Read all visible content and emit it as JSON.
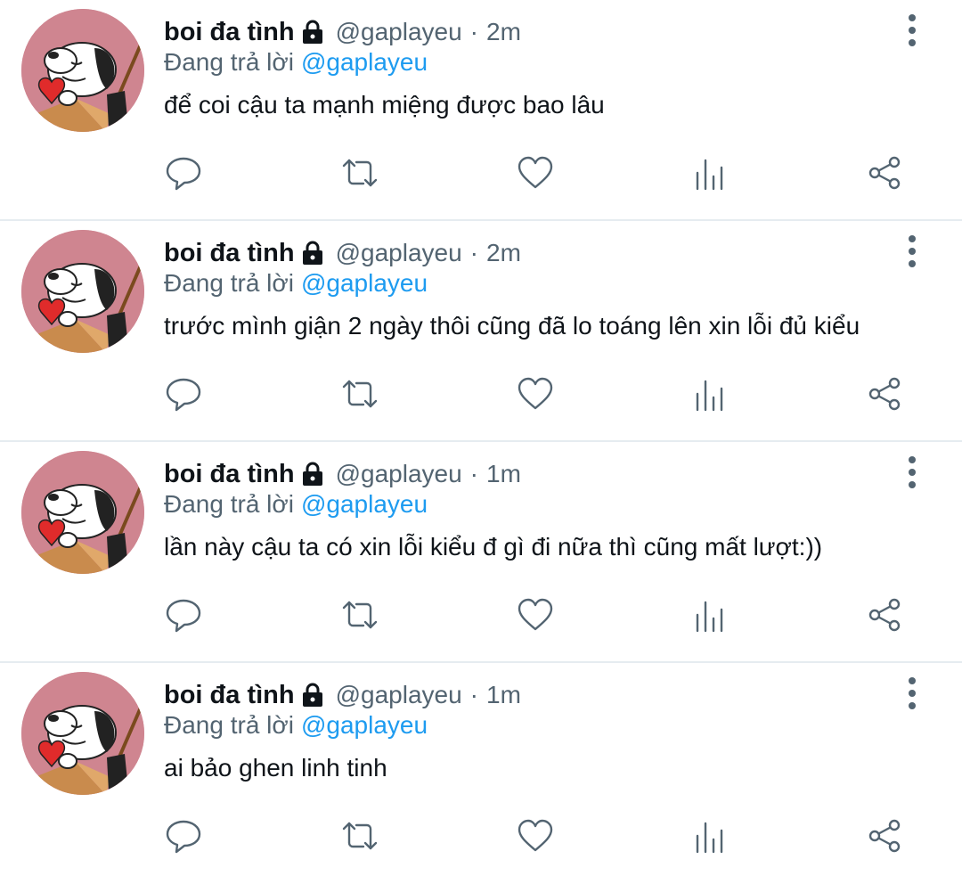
{
  "tweets": [
    {
      "display_name": "boi đa tình",
      "handle": "@gaplayeu",
      "separator": "·",
      "time": "2m",
      "replying_prefix": "Đang trả lời",
      "replying_to": "@gaplayeu",
      "text": "để coi cậu ta mạnh miệng được bao lâu"
    },
    {
      "display_name": "boi đa tình",
      "handle": "@gaplayeu",
      "separator": "·",
      "time": "2m",
      "replying_prefix": "Đang trả lời",
      "replying_to": "@gaplayeu",
      "text": "trước mình giận 2 ngày thôi cũng đã lo toáng lên xin lỗi đủ kiểu"
    },
    {
      "display_name": "boi đa tình",
      "handle": "@gaplayeu",
      "separator": "·",
      "time": "1m",
      "replying_prefix": "Đang trả lời",
      "replying_to": "@gaplayeu",
      "text": "lần này cậu ta có xin lỗi kiểu đ gì đi nữa thì cũng mất lượt:))"
    },
    {
      "display_name": "boi đa tình",
      "handle": "@gaplayeu",
      "separator": "·",
      "time": "1m",
      "replying_prefix": "Đang trả lời",
      "replying_to": "@gaplayeu",
      "text": "ai bảo ghen linh tinh"
    }
  ],
  "icons": {
    "avatar": "snoopy-avatar",
    "lock": "lock-icon",
    "more": "more-vertical-icon",
    "reply": "reply-icon",
    "retweet": "retweet-icon",
    "like": "heart-icon",
    "stats": "analytics-icon",
    "share": "share-icon"
  },
  "colors": {
    "text_primary": "#0f1419",
    "text_secondary": "#536471",
    "accent": "#1d9bf0",
    "avatar_bg": "#cf8590",
    "divider": "#e6ecf0"
  }
}
